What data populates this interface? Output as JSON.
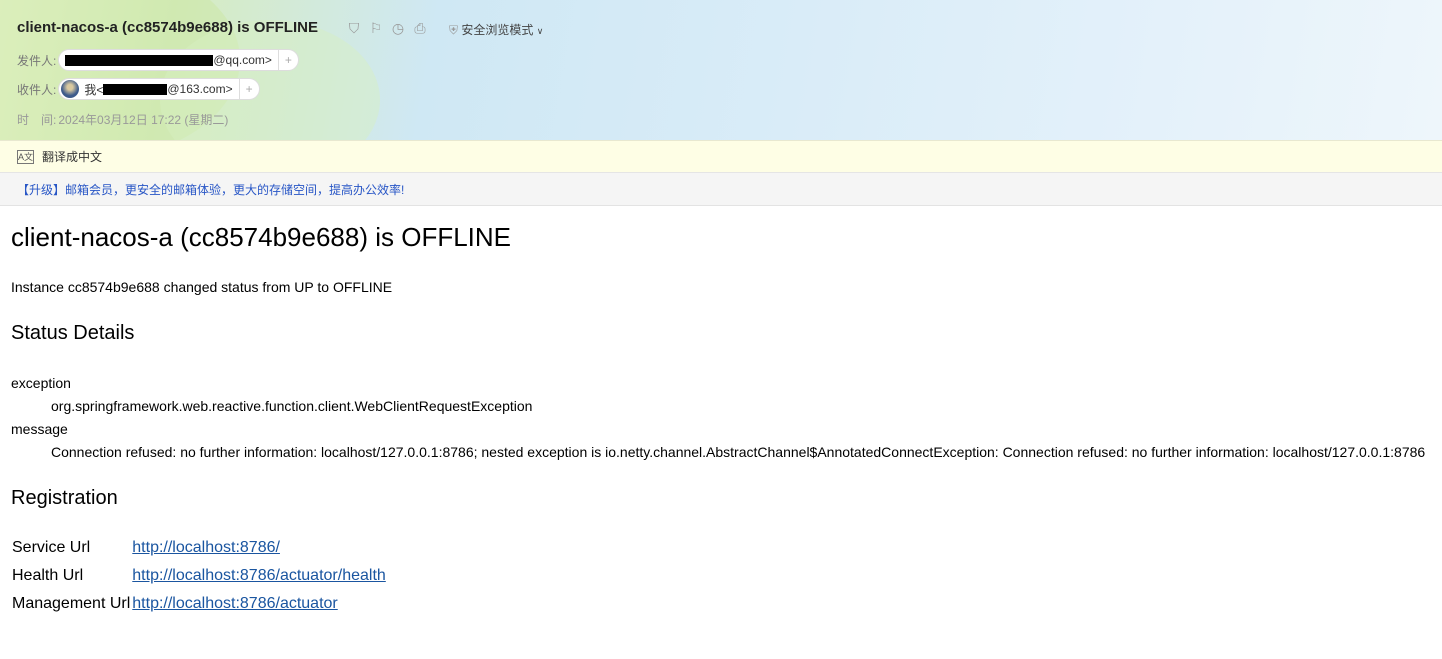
{
  "header": {
    "subject": "client-nacos-a (cc8574b9e688) is OFFLINE",
    "icons": [
      "bookmark-icon",
      "flag-icon",
      "clock-icon",
      "print-icon"
    ],
    "safe_mode": "安全浏览模式",
    "sender_label": "发件人:",
    "sender_email": "@qq.com>",
    "recipient_label": "收件人:",
    "recipient_prefix": "我<",
    "recipient_email": "@163.com>",
    "add": "+",
    "time_label": "时　间:",
    "time_value": "2024年03月12日 17:22 (星期二)"
  },
  "translate": {
    "label": "翻译成中文"
  },
  "promo": {
    "text": "【升级】邮箱会员，更安全的邮箱体验，更大的存储空间，提高办公效率!"
  },
  "mail": {
    "heading": "client-nacos-a (cc8574b9e688) is OFFLINE",
    "intro": "Instance cc8574b9e688 changed status from UP to OFFLINE",
    "status_title": "Status Details",
    "details": [
      {
        "key": "exception",
        "value": "org.springframework.web.reactive.function.client.WebClientRequestException"
      },
      {
        "key": "message",
        "value": "Connection refused: no further information: localhost/127.0.0.1:8786; nested exception is io.netty.channel.AbstractChannel$AnnotatedConnectException: Connection refused: no further information: localhost/127.0.0.1:8786"
      }
    ],
    "registration_title": "Registration",
    "registration": [
      {
        "label": "Service Url",
        "url": "http://localhost:8786/"
      },
      {
        "label": "Health Url",
        "url": "http://localhost:8786/actuator/health"
      },
      {
        "label": "Management Url",
        "url": "http://localhost:8786/actuator"
      }
    ]
  }
}
